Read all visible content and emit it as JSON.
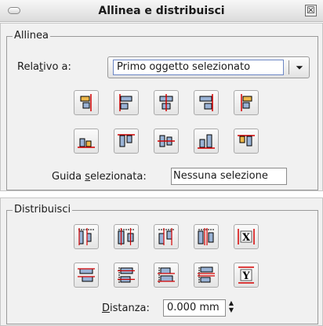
{
  "window": {
    "title": "Allinea e distribuisci",
    "close_glyph": "☒"
  },
  "align": {
    "frame_label": "Allinea",
    "relative_label_pre": "Rela",
    "relative_label_mnemonic": "t",
    "relative_label_post": "ivo a:",
    "relative_value": "Primo oggetto selezionato",
    "buttons_row1": [
      "align-right-edges-to-left-icon",
      "align-left-edges-icon",
      "center-horizontally-icon",
      "align-right-edges-icon",
      "align-left-edges-to-right-icon"
    ],
    "buttons_row2": [
      "align-bottom-edges-to-top-icon",
      "align-top-edges-icon",
      "center-vertically-icon",
      "align-bottom-edges-icon",
      "align-top-edges-to-bottom-icon"
    ],
    "guide_label_pre": "Guida ",
    "guide_label_mnemonic": "s",
    "guide_label_post": "elezionata:",
    "guide_value": "Nessuna selezione"
  },
  "distribute": {
    "frame_label": "Distribuisci",
    "buttons_row1": [
      "distribute-left-edges-icon",
      "distribute-centers-horizontally-icon",
      "distribute-right-edges-icon",
      "distribute-horizontal-gaps-icon",
      "exchange-horizontal-icon"
    ],
    "buttons_row2": [
      "distribute-top-edges-icon",
      "distribute-centers-vertically-icon",
      "distribute-bottom-edges-icon",
      "distribute-vertical-gaps-icon",
      "exchange-vertical-icon"
    ],
    "distance_label_mnemonic": "D",
    "distance_label_post": "istanza:",
    "distance_value": "0.000 mm"
  },
  "colors": {
    "accent_red": "#d40000",
    "accent_blue": "#3a6ea5"
  }
}
